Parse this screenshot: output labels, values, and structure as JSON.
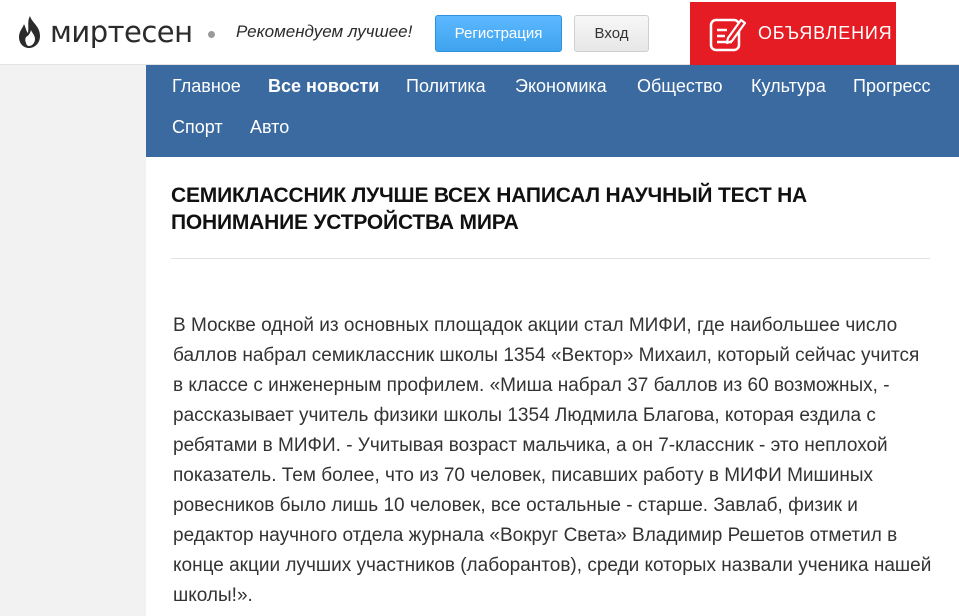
{
  "header": {
    "logo_text": "миртесен",
    "slogan": "Рекомендуем лучшее!",
    "register_label": "Регистрация",
    "login_label": "Вход",
    "ads_label": "ОБЪЯВЛЕНИЯ",
    "ads_color": "#e51c24",
    "logo_icon": "flame-icon",
    "ads_icon": "edit-note-icon"
  },
  "nav": {
    "items": [
      {
        "label": "Главное",
        "active": false
      },
      {
        "label": "Все новости",
        "active": true
      },
      {
        "label": "Политика",
        "active": false
      },
      {
        "label": "Экономика",
        "active": false
      },
      {
        "label": "Общество",
        "active": false
      },
      {
        "label": "Культура",
        "active": false
      },
      {
        "label": "Прогресс",
        "active": false
      },
      {
        "label": "Спорт",
        "active": false
      },
      {
        "label": "Авто",
        "active": false
      }
    ],
    "background": "#3a6a9f"
  },
  "article": {
    "title": "СЕМИКЛАССНИК ЛУЧШЕ ВСЕХ НАПИСАЛ НАУЧНЫЙ ТЕСТ НА ПОНИМАНИЕ УСТРОЙСТВА МИРА",
    "body": "В Москве одной из основных площадок акции стал МИФИ, где наибольшее число баллов набрал семиклассник школы 1354 «Вектор» Михаил, который сейчас учится в классе с инженерным профилем. «Миша набрал 37 баллов из 60 возможных, - рассказывает учитель физики школы 1354 Людмила Благова, которая ездила с ребятами в МИФИ. - Учитывая возраст мальчика, а он 7-классник - это неплохой показатель. Тем более, что из 70 человек, писавших работу в МИФИ Мишиных ровесников было лишь 10 человек, все остальные - старше. Завлаб, физик и редактор научного отдела журнала «Вокруг Света» Владимир Решетов отметил в конце акции лучших участников (лаборантов), среди которых назвали ученика нашей школы!»."
  }
}
